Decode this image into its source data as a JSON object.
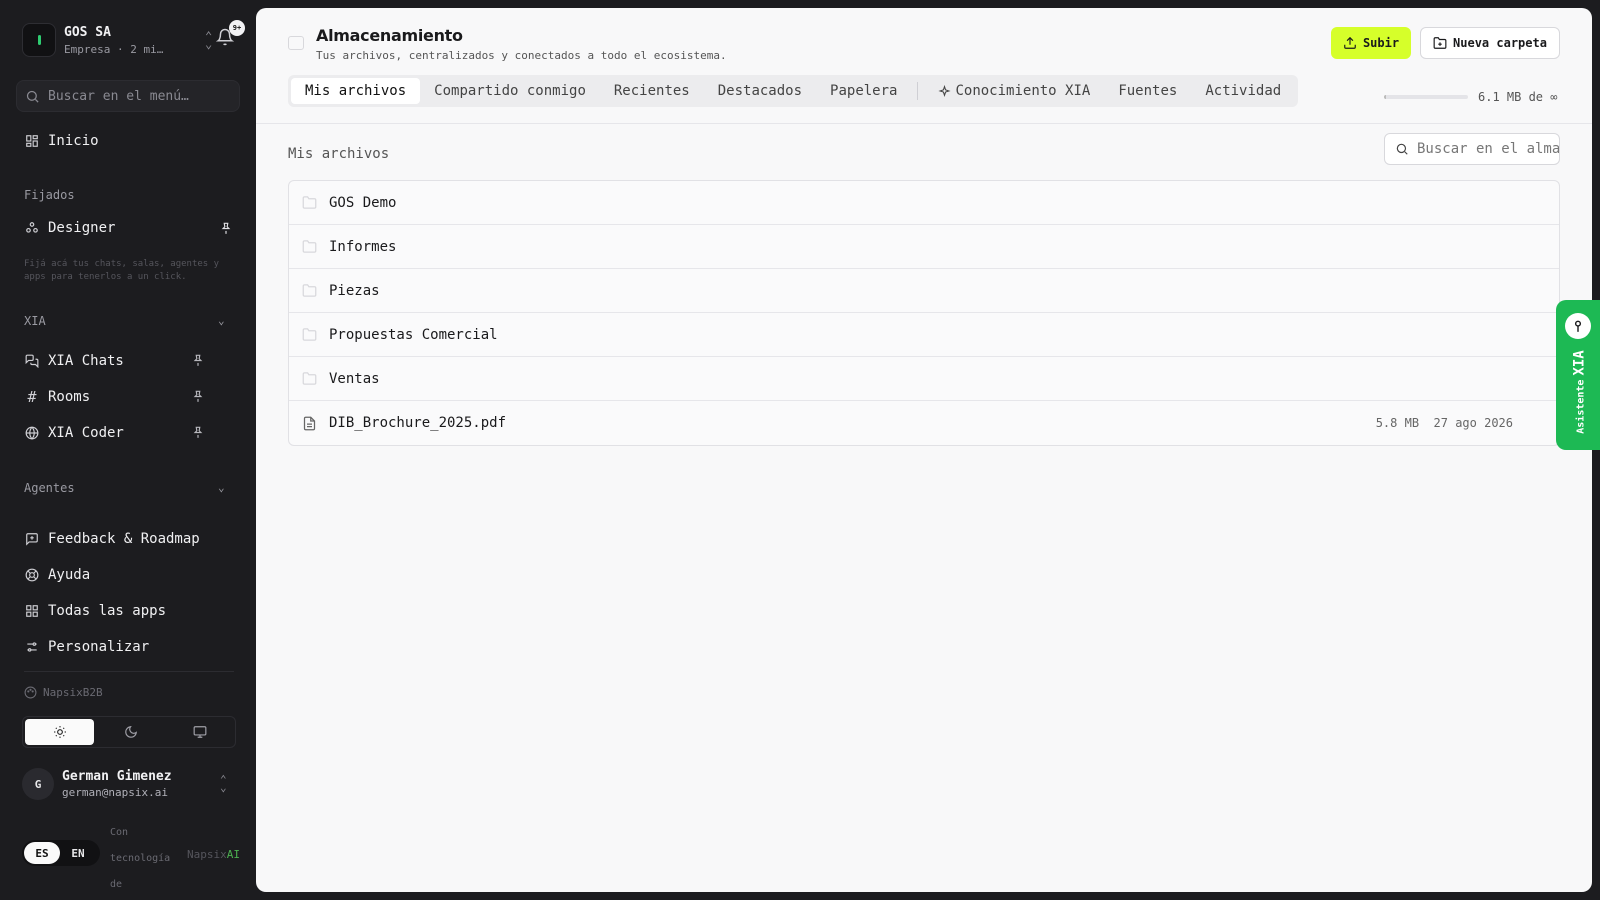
{
  "sidebar": {
    "org_name": "GOS SA",
    "org_sub": "Empresa · 2 mi…",
    "notif_badge": "9+",
    "search_placeholder": "Buscar en el menú…",
    "home_label": "Inicio",
    "pinned_section": "Fijados",
    "pinned_item": "Designer",
    "pinned_hint": "Fijá acá tus chats, salas, agentes y apps para tenerlos a un click.",
    "xia_section": "XIA",
    "xia_items": [
      {
        "label": "XIA Chats"
      },
      {
        "label": "Rooms"
      },
      {
        "label": "XIA Coder"
      }
    ],
    "agents_section": "Agentes",
    "bottom_items": [
      {
        "label": "Feedback & Roadmap"
      },
      {
        "label": "Ayuda"
      },
      {
        "label": "Todas las apps"
      },
      {
        "label": "Personalizar"
      }
    ],
    "brand": "NapsixB2B",
    "user_initial": "G",
    "user_name": "German Gimenez",
    "user_email": "german@napsix.ai",
    "lang_es": "ES",
    "lang_en": "EN",
    "powered_text": "Con tecnología de",
    "powered_logo_a": "Napsix",
    "powered_logo_b": "AI"
  },
  "header": {
    "title": "Almacenamiento",
    "subtitle": "Tus archivos, centralizados y conectados a todo el ecosistema.",
    "upload_label": "Subir",
    "new_folder_label": "Nueva carpeta",
    "tabs": [
      {
        "label": "Mis archivos"
      },
      {
        "label": "Compartido conmigo"
      },
      {
        "label": "Recientes"
      },
      {
        "label": "Destacados"
      },
      {
        "label": "Papelera"
      },
      {
        "label": "Conocimiento XIA"
      },
      {
        "label": "Fuentes"
      },
      {
        "label": "Actividad"
      }
    ],
    "storage_used": "6.1 MB de ∞"
  },
  "content": {
    "breadcrumb": "Mis archivos",
    "search_placeholder": "Buscar en el almacenamiento",
    "items": [
      {
        "name": "GOS Demo",
        "type": "folder",
        "size": "",
        "date": ""
      },
      {
        "name": "Informes",
        "type": "folder",
        "size": "",
        "date": ""
      },
      {
        "name": "Piezas",
        "type": "folder",
        "size": "",
        "date": ""
      },
      {
        "name": "Propuestas Comercial",
        "type": "folder",
        "size": "",
        "date": ""
      },
      {
        "name": "Ventas",
        "type": "folder",
        "size": "",
        "date": ""
      },
      {
        "name": "DIB_Brochure_2025.pdf",
        "type": "file",
        "size": "5.8 MB",
        "date": "27 ago 2026"
      }
    ]
  },
  "assistant": {
    "label_small": "Asistente",
    "label_big": "XIA"
  },
  "colors": {
    "accent": "#d6ff2a",
    "assistant": "#1db954",
    "sidebar_bg": "#1c1c1f"
  }
}
